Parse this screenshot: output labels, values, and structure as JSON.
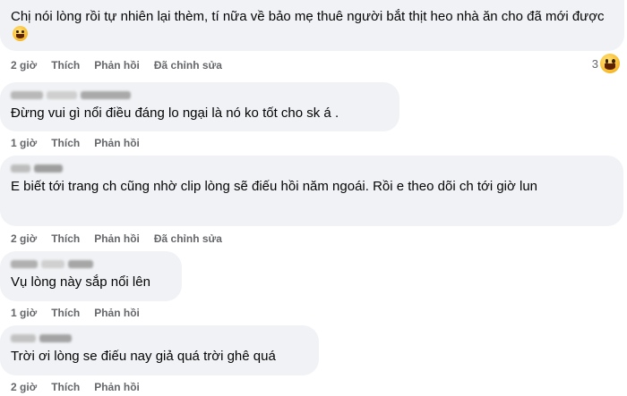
{
  "comments": [
    {
      "text": "Chị nói lòng rồi tự nhiên lại thèm, tí nữa về bảo mẹ thuê người bắt thịt heo nhà ăn cho đã mới được",
      "time": "2 giờ",
      "like": "Thích",
      "reply": "Phản hồi",
      "edited": "Đã chỉnh sửa",
      "reaction_count": "3",
      "reaction_icon": "laughing-emoji-icon",
      "text_emoji": "grinning-emoji-icon"
    },
    {
      "text": "Đừng vui gì nổi điều đáng lo ngại là nó ko tốt cho sk á .",
      "time": "1 giờ",
      "like": "Thích",
      "reply": "Phản hồi"
    },
    {
      "text": "E biết tới trang ch cũng nhờ clip lòng sẽ điếu hồi năm ngoái. Rồi e theo dõi ch tới giờ lun",
      "time": "2 giờ",
      "like": "Thích",
      "reply": "Phản hồi",
      "edited": "Đã chỉnh sửa"
    },
    {
      "text": "Vụ lòng này sắp nổi lên",
      "time": "1 giờ",
      "like": "Thích",
      "reply": "Phản hồi"
    },
    {
      "text": "Trời ơi lòng se điếu nay giả quá trời ghê quá",
      "time": "2 giờ",
      "like": "Thích",
      "reply": "Phản hồi"
    }
  ],
  "colors": {
    "bubble": "#f0f2f5",
    "meta_text": "#65676b",
    "body_text": "#050505"
  }
}
